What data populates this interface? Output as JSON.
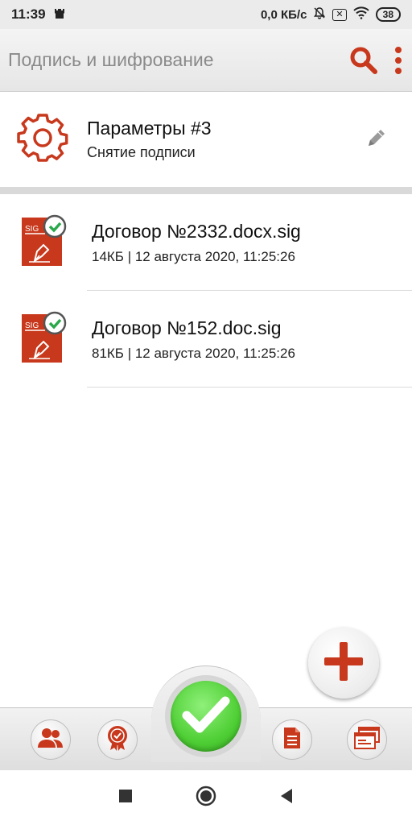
{
  "status_bar": {
    "time": "11:39",
    "network_speed": "0,0 КБ/с",
    "sim_box": "✕",
    "battery": "38"
  },
  "app_bar": {
    "title": "Подпись и шифрование"
  },
  "params": {
    "title": "Параметры #3",
    "subtitle": "Снятие подписи"
  },
  "files": [
    {
      "name": "Договор №2332.docx.sig",
      "meta": "14КБ | 12 августа 2020, 11:25:26",
      "badge": "SIG"
    },
    {
      "name": "Договор №152.doc.sig",
      "meta": "81КБ | 12 августа 2020, 11:25:26",
      "badge": "SIG"
    }
  ],
  "colors": {
    "accent": "#c8381c",
    "confirm_green": "#4fcf35",
    "toolbar": "#e6e6e6"
  },
  "icons": {
    "search": "search-icon",
    "more": "more-vertical-icon",
    "settings": "gear-icon",
    "edit": "pencil-icon",
    "add": "plus-icon",
    "contacts": "users-icon",
    "certificates": "certificate-icon",
    "confirm": "check-icon",
    "documents": "document-icon",
    "windows": "windows-icon"
  }
}
